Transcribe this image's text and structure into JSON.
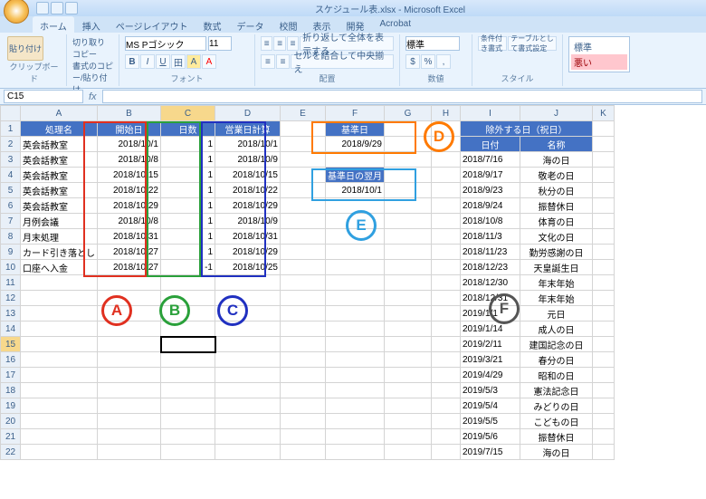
{
  "app": {
    "title": "スケジュール表.xlsx - Microsoft Excel"
  },
  "tabs": [
    "ホーム",
    "挿入",
    "ページレイアウト",
    "数式",
    "データ",
    "校閲",
    "表示",
    "開発",
    "Acrobat"
  ],
  "ribbon": {
    "paste": "貼り付け",
    "cut": "切り取り",
    "copy": "コピー",
    "fmtpaint": "書式のコピー/貼り付け",
    "g_clip": "クリップボード",
    "g_font": "フォント",
    "g_align": "配置",
    "g_num": "数値",
    "g_style": "スタイル",
    "font_name": "MS Pゴシック",
    "font_size": "11",
    "wrap": "折り返して全体を表示する",
    "merge": "セルを結合して中央揃え",
    "numfmt": "標準",
    "condfmt": "条件付き書式",
    "tblfmt": "テーブルとして書式設定",
    "style1": "標準",
    "style2": "悪い"
  },
  "namebox": "C15",
  "cols": [
    "A",
    "B",
    "C",
    "D",
    "E",
    "F",
    "G",
    "H",
    "I",
    "J",
    "K"
  ],
  "headers": {
    "A": "処理名",
    "B": "開始日",
    "C": "日数",
    "D": "営業日計算",
    "F": "基準日",
    "F2": "基準日の翌月",
    "I": "除外する日（祝日）",
    "I_d": "日付",
    "J_d": "名称"
  },
  "data": {
    "rows": [
      {
        "a": "英会話教室",
        "b": "2018/10/1",
        "c": "1",
        "d": "2018/10/1"
      },
      {
        "a": "英会話教室",
        "b": "2018/10/8",
        "c": "1",
        "d": "2018/10/9"
      },
      {
        "a": "英会話教室",
        "b": "2018/10/15",
        "c": "1",
        "d": "2018/10/15"
      },
      {
        "a": "英会話教室",
        "b": "2018/10/22",
        "c": "1",
        "d": "2018/10/22"
      },
      {
        "a": "英会話教室",
        "b": "2018/10/29",
        "c": "1",
        "d": "2018/10/29"
      },
      {
        "a": "月例会議",
        "b": "2018/10/8",
        "c": "1",
        "d": "2018/10/9"
      },
      {
        "a": "月末処理",
        "b": "2018/10/31",
        "c": "1",
        "d": "2018/10/31"
      },
      {
        "a": "カード引き落とし",
        "b": "2018/10/27",
        "c": "1",
        "d": "2018/10/29"
      },
      {
        "a": "口座へ入金",
        "b": "2018/10/27",
        "c": "-1",
        "d": "2018/10/25"
      }
    ],
    "ref": {
      "f2": "2018/9/29",
      "f5": "2018/10/1"
    },
    "holidays": [
      {
        "d": "2018/7/16",
        "n": "海の日"
      },
      {
        "d": "2018/9/17",
        "n": "敬老の日"
      },
      {
        "d": "2018/9/23",
        "n": "秋分の日"
      },
      {
        "d": "2018/9/24",
        "n": "振替休日"
      },
      {
        "d": "2018/10/8",
        "n": "体育の日"
      },
      {
        "d": "2018/11/3",
        "n": "文化の日"
      },
      {
        "d": "2018/11/23",
        "n": "勤労感謝の日"
      },
      {
        "d": "2018/12/23",
        "n": "天皇誕生日"
      },
      {
        "d": "2018/12/30",
        "n": "年末年始"
      },
      {
        "d": "2018/12/31",
        "n": "年末年始"
      },
      {
        "d": "2019/1/1",
        "n": "元日"
      },
      {
        "d": "2019/1/14",
        "n": "成人の日"
      },
      {
        "d": "2019/2/11",
        "n": "建国記念の日"
      },
      {
        "d": "2019/3/21",
        "n": "春分の日"
      },
      {
        "d": "2019/4/29",
        "n": "昭和の日"
      },
      {
        "d": "2019/5/3",
        "n": "憲法記念日"
      },
      {
        "d": "2019/5/4",
        "n": "みどりの日"
      },
      {
        "d": "2019/5/5",
        "n": "こどもの日"
      },
      {
        "d": "2019/5/6",
        "n": "振替休日"
      },
      {
        "d": "2019/7/15",
        "n": "海の日"
      }
    ]
  },
  "ann": {
    "A": "A",
    "B": "B",
    "C": "C",
    "D": "D",
    "E": "E",
    "F": "F"
  }
}
